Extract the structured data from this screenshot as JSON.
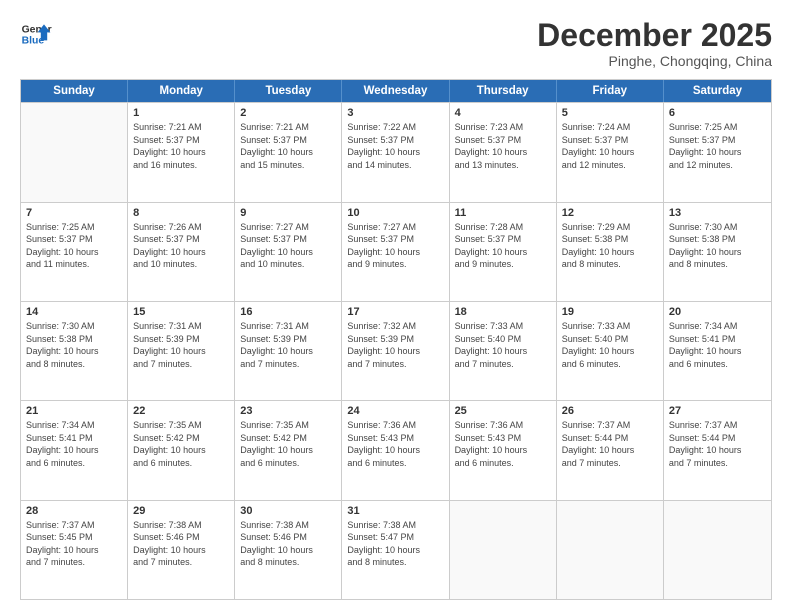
{
  "logo": {
    "line1": "General",
    "line2": "Blue"
  },
  "title": "December 2025",
  "subtitle": "Pinghe, Chongqing, China",
  "header_days": [
    "Sunday",
    "Monday",
    "Tuesday",
    "Wednesday",
    "Thursday",
    "Friday",
    "Saturday"
  ],
  "weeks": [
    [
      {
        "num": "",
        "info": ""
      },
      {
        "num": "1",
        "info": "Sunrise: 7:21 AM\nSunset: 5:37 PM\nDaylight: 10 hours\nand 16 minutes."
      },
      {
        "num": "2",
        "info": "Sunrise: 7:21 AM\nSunset: 5:37 PM\nDaylight: 10 hours\nand 15 minutes."
      },
      {
        "num": "3",
        "info": "Sunrise: 7:22 AM\nSunset: 5:37 PM\nDaylight: 10 hours\nand 14 minutes."
      },
      {
        "num": "4",
        "info": "Sunrise: 7:23 AM\nSunset: 5:37 PM\nDaylight: 10 hours\nand 13 minutes."
      },
      {
        "num": "5",
        "info": "Sunrise: 7:24 AM\nSunset: 5:37 PM\nDaylight: 10 hours\nand 12 minutes."
      },
      {
        "num": "6",
        "info": "Sunrise: 7:25 AM\nSunset: 5:37 PM\nDaylight: 10 hours\nand 12 minutes."
      }
    ],
    [
      {
        "num": "7",
        "info": "Sunrise: 7:25 AM\nSunset: 5:37 PM\nDaylight: 10 hours\nand 11 minutes."
      },
      {
        "num": "8",
        "info": "Sunrise: 7:26 AM\nSunset: 5:37 PM\nDaylight: 10 hours\nand 10 minutes."
      },
      {
        "num": "9",
        "info": "Sunrise: 7:27 AM\nSunset: 5:37 PM\nDaylight: 10 hours\nand 10 minutes."
      },
      {
        "num": "10",
        "info": "Sunrise: 7:27 AM\nSunset: 5:37 PM\nDaylight: 10 hours\nand 9 minutes."
      },
      {
        "num": "11",
        "info": "Sunrise: 7:28 AM\nSunset: 5:37 PM\nDaylight: 10 hours\nand 9 minutes."
      },
      {
        "num": "12",
        "info": "Sunrise: 7:29 AM\nSunset: 5:38 PM\nDaylight: 10 hours\nand 8 minutes."
      },
      {
        "num": "13",
        "info": "Sunrise: 7:30 AM\nSunset: 5:38 PM\nDaylight: 10 hours\nand 8 minutes."
      }
    ],
    [
      {
        "num": "14",
        "info": "Sunrise: 7:30 AM\nSunset: 5:38 PM\nDaylight: 10 hours\nand 8 minutes."
      },
      {
        "num": "15",
        "info": "Sunrise: 7:31 AM\nSunset: 5:39 PM\nDaylight: 10 hours\nand 7 minutes."
      },
      {
        "num": "16",
        "info": "Sunrise: 7:31 AM\nSunset: 5:39 PM\nDaylight: 10 hours\nand 7 minutes."
      },
      {
        "num": "17",
        "info": "Sunrise: 7:32 AM\nSunset: 5:39 PM\nDaylight: 10 hours\nand 7 minutes."
      },
      {
        "num": "18",
        "info": "Sunrise: 7:33 AM\nSunset: 5:40 PM\nDaylight: 10 hours\nand 7 minutes."
      },
      {
        "num": "19",
        "info": "Sunrise: 7:33 AM\nSunset: 5:40 PM\nDaylight: 10 hours\nand 6 minutes."
      },
      {
        "num": "20",
        "info": "Sunrise: 7:34 AM\nSunset: 5:41 PM\nDaylight: 10 hours\nand 6 minutes."
      }
    ],
    [
      {
        "num": "21",
        "info": "Sunrise: 7:34 AM\nSunset: 5:41 PM\nDaylight: 10 hours\nand 6 minutes."
      },
      {
        "num": "22",
        "info": "Sunrise: 7:35 AM\nSunset: 5:42 PM\nDaylight: 10 hours\nand 6 minutes."
      },
      {
        "num": "23",
        "info": "Sunrise: 7:35 AM\nSunset: 5:42 PM\nDaylight: 10 hours\nand 6 minutes."
      },
      {
        "num": "24",
        "info": "Sunrise: 7:36 AM\nSunset: 5:43 PM\nDaylight: 10 hours\nand 6 minutes."
      },
      {
        "num": "25",
        "info": "Sunrise: 7:36 AM\nSunset: 5:43 PM\nDaylight: 10 hours\nand 6 minutes."
      },
      {
        "num": "26",
        "info": "Sunrise: 7:37 AM\nSunset: 5:44 PM\nDaylight: 10 hours\nand 7 minutes."
      },
      {
        "num": "27",
        "info": "Sunrise: 7:37 AM\nSunset: 5:44 PM\nDaylight: 10 hours\nand 7 minutes."
      }
    ],
    [
      {
        "num": "28",
        "info": "Sunrise: 7:37 AM\nSunset: 5:45 PM\nDaylight: 10 hours\nand 7 minutes."
      },
      {
        "num": "29",
        "info": "Sunrise: 7:38 AM\nSunset: 5:46 PM\nDaylight: 10 hours\nand 7 minutes."
      },
      {
        "num": "30",
        "info": "Sunrise: 7:38 AM\nSunset: 5:46 PM\nDaylight: 10 hours\nand 8 minutes."
      },
      {
        "num": "31",
        "info": "Sunrise: 7:38 AM\nSunset: 5:47 PM\nDaylight: 10 hours\nand 8 minutes."
      },
      {
        "num": "",
        "info": ""
      },
      {
        "num": "",
        "info": ""
      },
      {
        "num": "",
        "info": ""
      }
    ]
  ]
}
